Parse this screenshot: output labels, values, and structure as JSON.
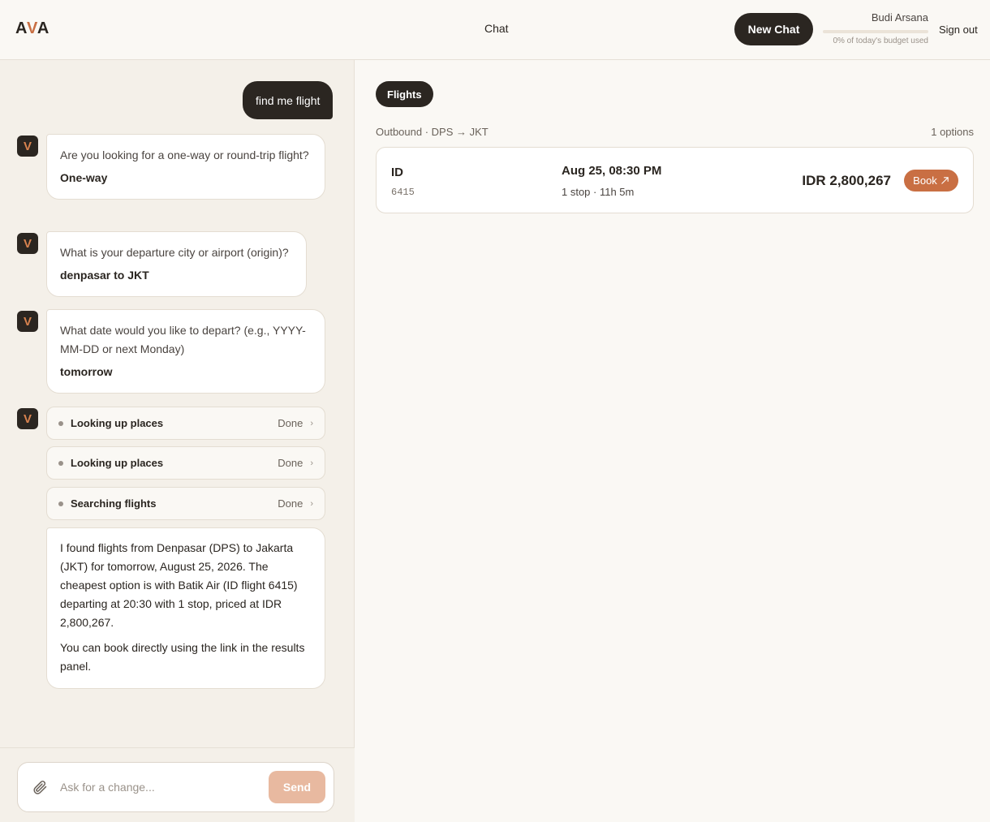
{
  "header": {
    "logo_left": "A",
    "logo_accent": "V",
    "logo_right": "A",
    "nav_chat": "Chat",
    "new_chat_label": "New Chat",
    "user_name": "Budi Arsana",
    "budget_used_percent": 0,
    "budget_text": "0% of today's budget used",
    "sign_out_label": "Sign out",
    "accent_color": "#c96f43"
  },
  "chat": {
    "user_message": "find me flight",
    "assistant_initial": "V",
    "qa": [
      {
        "question": "Are you looking for a one-way or round-trip flight?",
        "answer": "One-way"
      },
      {
        "question": "What is your departure city or airport (origin)?",
        "answer": "denpasar to JKT"
      },
      {
        "question": "What date would you like to depart? (e.g., YYYY-MM-DD or next Monday)",
        "answer": "tomorrow"
      }
    ],
    "tools": [
      {
        "label": "Looking up places",
        "status": "Done"
      },
      {
        "label": "Looking up places",
        "status": "Done"
      },
      {
        "label": "Searching flights",
        "status": "Done"
      }
    ],
    "result_paragraphs": [
      "I found flights from Denpasar (DPS) to Jakarta (JKT) for tomorrow, August 25, 2026. The cheapest option is with Batik Air (ID flight 6415) departing at 20:30 with 1 stop, priced at IDR 2,800,267.",
      "You can book directly using the link in the results panel."
    ]
  },
  "composer": {
    "placeholder": "Ask for a change...",
    "value": "",
    "send_label": "Send",
    "attach_icon": "paperclip-icon"
  },
  "results": {
    "tab_label": "Flights",
    "route_label": "Outbound · DPS → JKT",
    "options_count": "1 options",
    "flights": [
      {
        "airline_code": "ID",
        "flight_number": "6415",
        "departure": "Aug 25, 08:30 PM",
        "stops_duration": "1 stop · 11h 5m",
        "price": "IDR 2,800,267",
        "book_label": "Book",
        "book_icon": "external-link-icon"
      }
    ]
  }
}
